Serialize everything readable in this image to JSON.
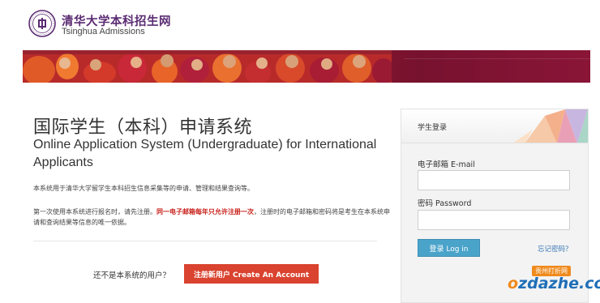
{
  "header": {
    "logo_cn": "清华大学本科招生网",
    "logo_en": "Tsinghua Admissions",
    "seal_icon": "tsinghua-seal-icon"
  },
  "main": {
    "title_cn": "国际学生（本科）申请系统",
    "title_en": "Online Application System (Undergraduate) for International Applicants",
    "desc1": "本系统用于清华大学留学生本科招生信息采集等的申请、管理和结果查询等。",
    "desc2_a": "第一次使用本系统进行报名时，请先注册。",
    "desc2_highlight": "同一电子邮箱每年只允许注册一次",
    "desc2_b": "，注册时的电子邮箱和密码将是考生在本系统申请和查询结果等信息的唯一依据。",
    "not_user": "还不是本系统的用户？",
    "register_label": "注册新用户 Create An Account"
  },
  "login": {
    "title": "学生登录",
    "email_label": "电子邮箱 E-mail",
    "email_value": "",
    "password_label": "密码 Password",
    "password_value": "",
    "login_button": "登录 Log in",
    "forgot": "忘记密码？"
  },
  "watermark": {
    "tag": "贵州打折网",
    "text_o": "o",
    "text_rest": "zdazhe.com"
  },
  "colors": {
    "brand_purple": "#5a2b72",
    "register_red": "#d9432f",
    "login_blue": "#4aa3c9",
    "banner_crimson": "#7a1230",
    "highlight_red": "#c8201a"
  }
}
